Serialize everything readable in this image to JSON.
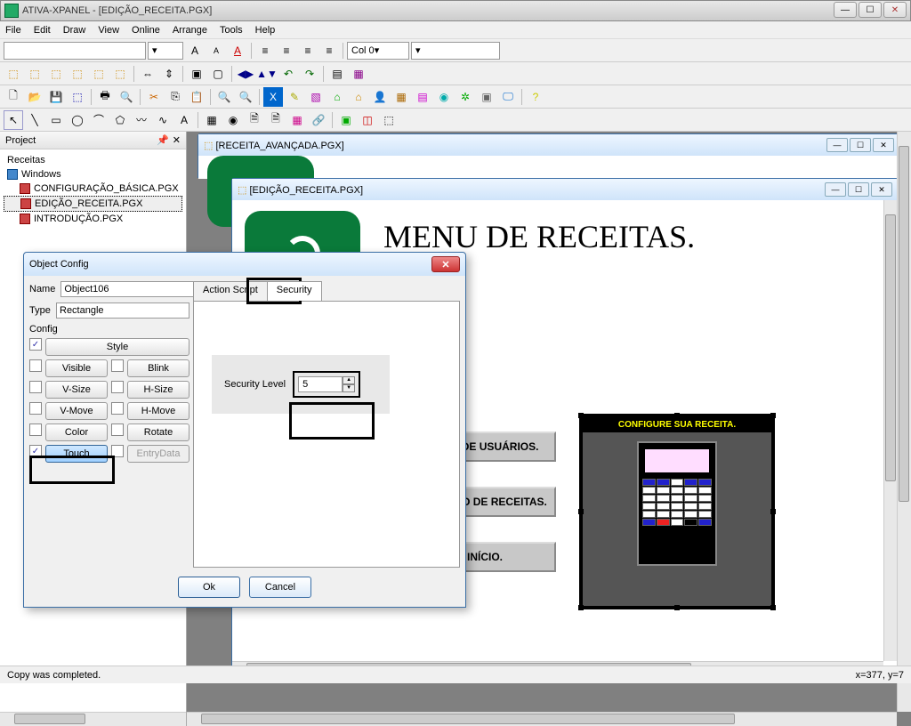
{
  "title": "ATIVA-XPANEL - [EDIÇÃO_RECEITA.PGX]",
  "menu": {
    "file": "File",
    "edit": "Edit",
    "draw": "Draw",
    "view": "View",
    "online": "Online",
    "arrange": "Arrange",
    "tools": "Tools",
    "help": "Help"
  },
  "toolbar": {
    "col_combo": "Col 0"
  },
  "sidebar": {
    "panel_title": "Project",
    "root": "Receitas",
    "windows": "Windows",
    "items": [
      "CONFIGURAÇÃO_BÁSICA.PGX",
      "EDIÇÃO_RECEITA.PGX",
      "INTRODUÇÃO.PGX"
    ]
  },
  "mdi1": {
    "title": "[RECEITA_AVANÇADA.PGX]"
  },
  "mdi2": {
    "title": "[EDIÇÃO_RECEITA.PGX]",
    "heading": "MENU DE RECEITAS.",
    "btn1": "TELA DE USUÁRIOS.",
    "btn2": "QUADRO DE RECEITAS.",
    "btn3": "INÍCIO.",
    "recipe_label": "CONFIGURE SUA RECEITA."
  },
  "dialog": {
    "title": "Object Config",
    "name_label": "Name",
    "name_value": "Object106",
    "type_label": "Type",
    "type_value": "Rectangle",
    "config_label": "Config",
    "btns": {
      "style": "Style",
      "visible": "Visible",
      "blink": "Blink",
      "vsize": "V-Size",
      "hsize": "H-Size",
      "vmove": "V-Move",
      "hmove": "H-Move",
      "color": "Color",
      "rotate": "Rotate",
      "touch": "Touch",
      "entrydata": "EntryData"
    },
    "tabs": {
      "action": "Action Script",
      "security": "Security"
    },
    "security_label": "Security Level",
    "security_value": "5",
    "ok": "Ok",
    "cancel": "Cancel"
  },
  "status": {
    "left": "Copy was completed.",
    "right": "x=377, y=7"
  }
}
